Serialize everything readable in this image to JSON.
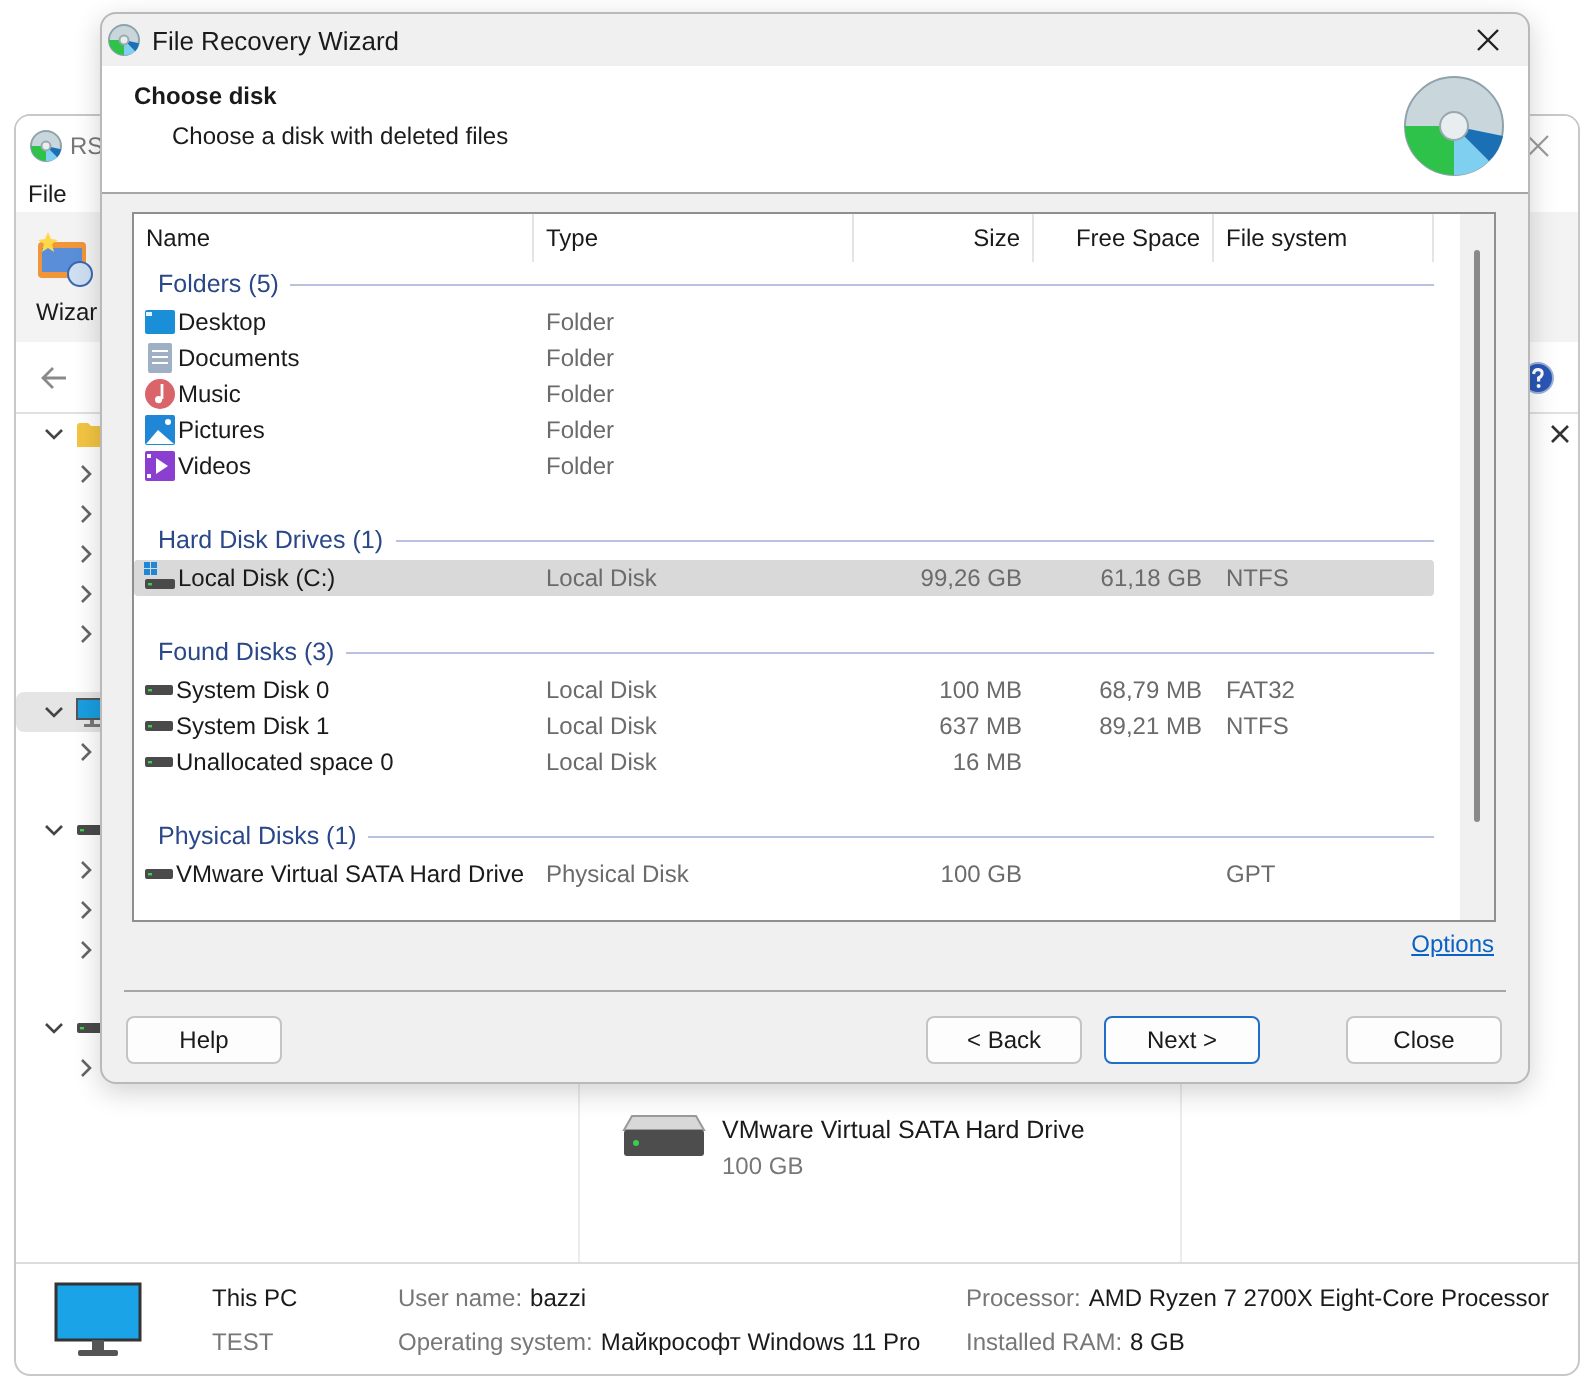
{
  "background_window": {
    "title": "RS",
    "menu": [
      "File"
    ],
    "toolbar": [
      {
        "label": "Wizar"
      }
    ],
    "tree": [
      {
        "kind": "folder",
        "expanded": true,
        "selected": false,
        "children": [
          {
            "expanded": false
          },
          {
            "expanded": false
          },
          {
            "expanded": false
          },
          {
            "expanded": false
          },
          {
            "expanded": false
          }
        ]
      },
      {
        "kind": "computer",
        "expanded": true,
        "selected": true,
        "children": [
          {
            "expanded": false
          }
        ]
      },
      {
        "kind": "disk",
        "expanded": true,
        "selected": false,
        "children": [
          {
            "expanded": false
          },
          {
            "expanded": false
          },
          {
            "expanded": false
          }
        ]
      },
      {
        "kind": "disk",
        "expanded": true,
        "selected": false,
        "children": [
          {
            "expanded": false
          }
        ]
      }
    ],
    "disk": {
      "name": "VMware Virtual SATA Hard Drive",
      "size": "100 GB"
    },
    "status": {
      "computer": "This PC",
      "computer_name": "TEST",
      "fields": [
        {
          "label": "User name:",
          "value": "bazzi"
        },
        {
          "label": "Processor:",
          "value": "AMD Ryzen 7 2700X Eight-Core Processor"
        },
        {
          "label": "Operating system:",
          "value": "Майкрософт Windows 11 Pro"
        },
        {
          "label": "Installed RAM:",
          "value": "8 GB"
        }
      ]
    }
  },
  "dialog": {
    "title": "File Recovery Wizard",
    "heading": "Choose disk",
    "subtitle": "Choose a disk with deleted files",
    "columns": [
      "Name",
      "Type",
      "Size",
      "Free Space",
      "File system"
    ],
    "groups": [
      {
        "title": "Folders (5)",
        "items": [
          {
            "kind": "desktop",
            "name": "Desktop",
            "type": "Folder",
            "selected": false
          },
          {
            "kind": "documents",
            "name": "Documents",
            "type": "Folder",
            "selected": false
          },
          {
            "kind": "music",
            "name": "Music",
            "type": "Folder",
            "selected": false
          },
          {
            "kind": "pictures",
            "name": "Pictures",
            "type": "Folder",
            "selected": false
          },
          {
            "kind": "videos",
            "name": "Videos",
            "type": "Folder",
            "selected": false
          }
        ]
      },
      {
        "title": "Hard Disk Drives (1)",
        "items": [
          {
            "kind": "system_drive",
            "name": "Local Disk (C:)",
            "type": "Local Disk",
            "size": "99,26 GB",
            "free_space": "61,18 GB",
            "file_system": "NTFS",
            "selected": true
          }
        ]
      },
      {
        "title": "Found Disks (3)",
        "items": [
          {
            "kind": "drive",
            "name": "System Disk 0",
            "type": "Local Disk",
            "size": "100 MB",
            "free_space": "68,79 MB",
            "file_system": "FAT32",
            "selected": false
          },
          {
            "kind": "drive",
            "name": "System Disk 1",
            "type": "Local Disk",
            "size": "637 MB",
            "free_space": "89,21 MB",
            "file_system": "NTFS",
            "selected": false
          },
          {
            "kind": "drive",
            "name": "Unallocated space 0",
            "type": "Local Disk",
            "size": "16 MB",
            "selected": false
          }
        ]
      },
      {
        "title": "Physical Disks (1)",
        "items": [
          {
            "kind": "drive",
            "name": "VMware Virtual SATA Hard Drive",
            "type": "Physical Disk",
            "size": "100 GB",
            "file_system": "GPT",
            "selected": false
          }
        ]
      }
    ],
    "options_link": "Options",
    "buttons": [
      {
        "kind": "help",
        "label": "Help",
        "default": false
      },
      {
        "kind": "nav",
        "label": "< Back",
        "default": false
      },
      {
        "kind": "nav",
        "label": "Next >",
        "default": true
      },
      {
        "kind": "close",
        "label": "Close",
        "default": false
      }
    ]
  }
}
